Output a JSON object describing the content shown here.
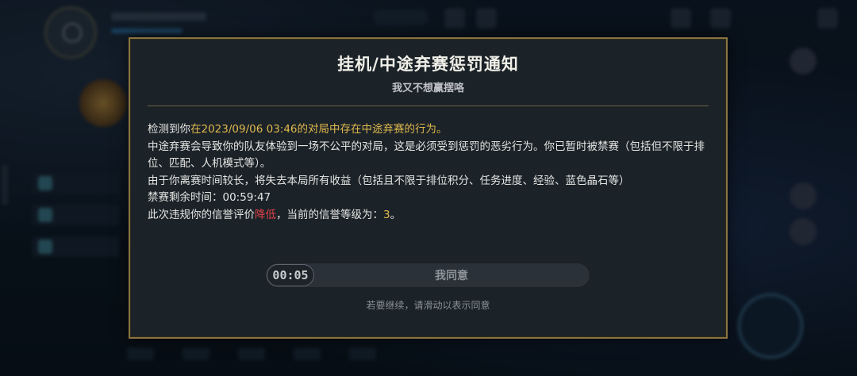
{
  "dialog": {
    "title": "挂机/中途弃赛惩罚通知",
    "subtitle": "我又不想赢摆咯",
    "lines": {
      "l1_prefix": "检测到你",
      "l1_highlight": "在2023/09/06 03:46的对局中存在中途弃赛的行为。",
      "l2": "中途弃赛会导致你的队友体验到一场不公平的对局，这是必须受到惩罚的恶劣行为。你已暂时被禁赛（包括但不限于排位、匹配、人机模式等）。",
      "l3": "由于你离赛时间较长，将失去本局所有收益（包括且不限于排位积分、任务进度、经验、蓝色晶石等）",
      "l4": "禁赛剩余时间：00:59:47",
      "l5_prefix": "此次违规你的信誉评价",
      "l5_red": "降低",
      "l5_mid": "，当前的信誉等级为：",
      "l5_level": "3",
      "l5_suffix": "。"
    },
    "slider": {
      "timer": "00:05",
      "label": "我同意"
    },
    "hint": "若要继续，请滑动以表示同意"
  },
  "colors": {
    "accent_gold": "#e0b94e",
    "warning_red": "#e0434a",
    "border_gold": "#8a7440",
    "dialog_bg": "#1b2228"
  }
}
